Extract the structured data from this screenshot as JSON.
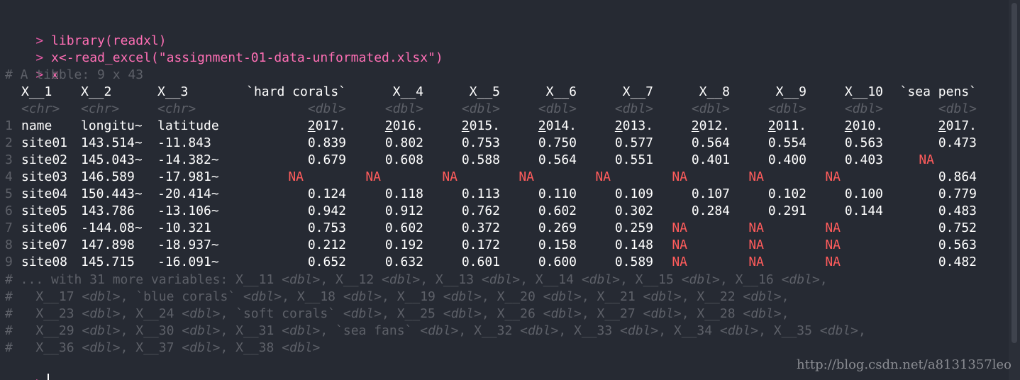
{
  "console": {
    "prompt_symbol": ">",
    "comment_symbol": "#",
    "commands": [
      "library(readxl)",
      "x<-read_excel(\"assignment-01-data-unformated.xlsx\")",
      "x"
    ],
    "tibble_header": "# A tibble: 9 x 43",
    "columns": [
      "X__1",
      "X__2",
      "X__3",
      "`hard corals`",
      "X__4",
      "X__5",
      "X__6",
      "X__7",
      "X__8",
      "X__9",
      "X__10",
      "`sea pens`"
    ],
    "types": [
      "<chr>",
      "<chr>",
      "<chr>",
      "<dbl>",
      "<dbl>",
      "<dbl>",
      "<dbl>",
      "<dbl>",
      "<dbl>",
      "<dbl>",
      "<dbl>",
      "<dbl>"
    ],
    "rows": [
      {
        "num": "1",
        "cells": [
          "name",
          "longitu~",
          "latitude",
          "2017.",
          "2016.",
          "2015.",
          "2014.",
          "2013.",
          "2012.",
          "2011.",
          "2010.",
          "2017."
        ]
      },
      {
        "num": "2",
        "cells": [
          "site01",
          "143.514~",
          "-11.843",
          "0.839",
          "0.802",
          "0.753",
          "0.750",
          "0.577",
          "0.564",
          "0.554",
          "0.563",
          "0.473"
        ]
      },
      {
        "num": "3",
        "cells": [
          "site02",
          "145.043~",
          "-14.382~",
          "0.679",
          "0.608",
          "0.588",
          "0.564",
          "0.551",
          "0.401",
          "0.400",
          "0.403",
          "NA"
        ]
      },
      {
        "num": "4",
        "cells": [
          "site03",
          "146.589",
          "-17.981~",
          "NA",
          "NA",
          "NA",
          "NA",
          "NA",
          "NA",
          "NA",
          "NA",
          "0.864"
        ]
      },
      {
        "num": "5",
        "cells": [
          "site04",
          "150.443~",
          "-20.414~",
          "0.124",
          "0.118",
          "0.113",
          "0.110",
          "0.109",
          "0.107",
          "0.102",
          "0.100",
          "0.779"
        ]
      },
      {
        "num": "6",
        "cells": [
          "site05",
          "143.786",
          "-13.106~",
          "0.942",
          "0.912",
          "0.762",
          "0.602",
          "0.302",
          "0.284",
          "0.291",
          "0.144",
          "0.483"
        ]
      },
      {
        "num": "7",
        "cells": [
          "site06",
          "-144.08~",
          "-10.321",
          "0.753",
          "0.602",
          "0.372",
          "0.269",
          "0.259",
          "NA",
          "NA",
          "NA",
          "0.752"
        ]
      },
      {
        "num": "8",
        "cells": [
          "site07",
          "147.898",
          "-18.937~",
          "0.212",
          "0.192",
          "0.172",
          "0.158",
          "0.148",
          "NA",
          "NA",
          "NA",
          "0.563"
        ]
      },
      {
        "num": "9",
        "cells": [
          "site08",
          "145.715",
          "-16.091~",
          "0.652",
          "0.632",
          "0.601",
          "0.600",
          "0.589",
          "NA",
          "NA",
          "NA",
          "0.482"
        ]
      }
    ],
    "footer": [
      [
        {
          "t": "# ... with 31 more variables: X__11 "
        },
        {
          "t": "<dbl>",
          "type": true
        },
        {
          "t": ", X__12 "
        },
        {
          "t": "<dbl>",
          "type": true
        },
        {
          "t": ", X__13 "
        },
        {
          "t": "<dbl>",
          "type": true
        },
        {
          "t": ", X__14 "
        },
        {
          "t": "<dbl>",
          "type": true
        },
        {
          "t": ", X__15 "
        },
        {
          "t": "<dbl>",
          "type": true
        },
        {
          "t": ", X__16 "
        },
        {
          "t": "<dbl>",
          "type": true
        },
        {
          "t": ","
        }
      ],
      [
        {
          "t": "#   X__17 "
        },
        {
          "t": "<dbl>",
          "type": true
        },
        {
          "t": ", `blue corals` "
        },
        {
          "t": "<dbl>",
          "type": true
        },
        {
          "t": ", X__18 "
        },
        {
          "t": "<dbl>",
          "type": true
        },
        {
          "t": ", X__19 "
        },
        {
          "t": "<dbl>",
          "type": true
        },
        {
          "t": ", X__20 "
        },
        {
          "t": "<dbl>",
          "type": true
        },
        {
          "t": ", X__21 "
        },
        {
          "t": "<dbl>",
          "type": true
        },
        {
          "t": ", X__22 "
        },
        {
          "t": "<dbl>",
          "type": true
        },
        {
          "t": ","
        }
      ],
      [
        {
          "t": "#   X__23 "
        },
        {
          "t": "<dbl>",
          "type": true
        },
        {
          "t": ", X__24 "
        },
        {
          "t": "<dbl>",
          "type": true
        },
        {
          "t": ", `soft corals` "
        },
        {
          "t": "<dbl>",
          "type": true
        },
        {
          "t": ", X__25 "
        },
        {
          "t": "<dbl>",
          "type": true
        },
        {
          "t": ", X__26 "
        },
        {
          "t": "<dbl>",
          "type": true
        },
        {
          "t": ", X__27 "
        },
        {
          "t": "<dbl>",
          "type": true
        },
        {
          "t": ", X__28 "
        },
        {
          "t": "<dbl>",
          "type": true
        },
        {
          "t": ","
        }
      ],
      [
        {
          "t": "#   X__29 "
        },
        {
          "t": "<dbl>",
          "type": true
        },
        {
          "t": ", X__30 "
        },
        {
          "t": "<dbl>",
          "type": true
        },
        {
          "t": ", X__31 "
        },
        {
          "t": "<dbl>",
          "type": true
        },
        {
          "t": ", `sea fans` "
        },
        {
          "t": "<dbl>",
          "type": true
        },
        {
          "t": ", X__32 "
        },
        {
          "t": "<dbl>",
          "type": true
        },
        {
          "t": ", X__33 "
        },
        {
          "t": "<dbl>",
          "type": true
        },
        {
          "t": ", X__34 "
        },
        {
          "t": "<dbl>",
          "type": true
        },
        {
          "t": ", X__35 "
        },
        {
          "t": "<dbl>",
          "type": true
        },
        {
          "t": ","
        }
      ],
      [
        {
          "t": "#   X__36 "
        },
        {
          "t": "<dbl>",
          "type": true
        },
        {
          "t": ", X__37 "
        },
        {
          "t": "<dbl>",
          "type": true
        },
        {
          "t": ", X__38 "
        },
        {
          "t": "<dbl>",
          "type": true
        }
      ]
    ]
  },
  "watermark": "http://blog.csdn.net/a8131357leo",
  "colors": {
    "background": "#262a33",
    "prompt": "#e05aa3",
    "command": "#ff6fb5",
    "comment": "#5d6068",
    "na": "#ff5c5c",
    "text": "#ffffff"
  }
}
